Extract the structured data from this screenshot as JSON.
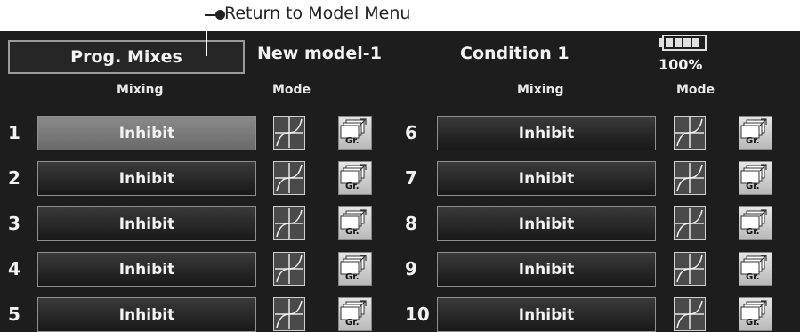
{
  "annotation": {
    "text": "Return to Model Menu"
  },
  "header": {
    "title": "Prog. Mixes",
    "model": "New model-1",
    "condition": "Condition 1",
    "battery": "100%"
  },
  "columns": {
    "mixing": "Mixing",
    "mode": "Mode"
  },
  "rows_left": [
    {
      "num": "1",
      "mixing": "Inhibit",
      "selected": true
    },
    {
      "num": "2",
      "mixing": "Inhibit"
    },
    {
      "num": "3",
      "mixing": "Inhibit"
    },
    {
      "num": "4",
      "mixing": "Inhibit"
    },
    {
      "num": "5",
      "mixing": "Inhibit"
    }
  ],
  "rows_right": [
    {
      "num": "6",
      "mixing": "Inhibit"
    },
    {
      "num": "7",
      "mixing": "Inhibit"
    },
    {
      "num": "8",
      "mixing": "Inhibit"
    },
    {
      "num": "9",
      "mixing": "Inhibit"
    },
    {
      "num": "10",
      "mixing": "Inhibit"
    }
  ],
  "group_label": "Gr.",
  "icons": {
    "mode": "curve-graph-icon",
    "group": "group-copy-icon",
    "battery": "battery-icon"
  }
}
